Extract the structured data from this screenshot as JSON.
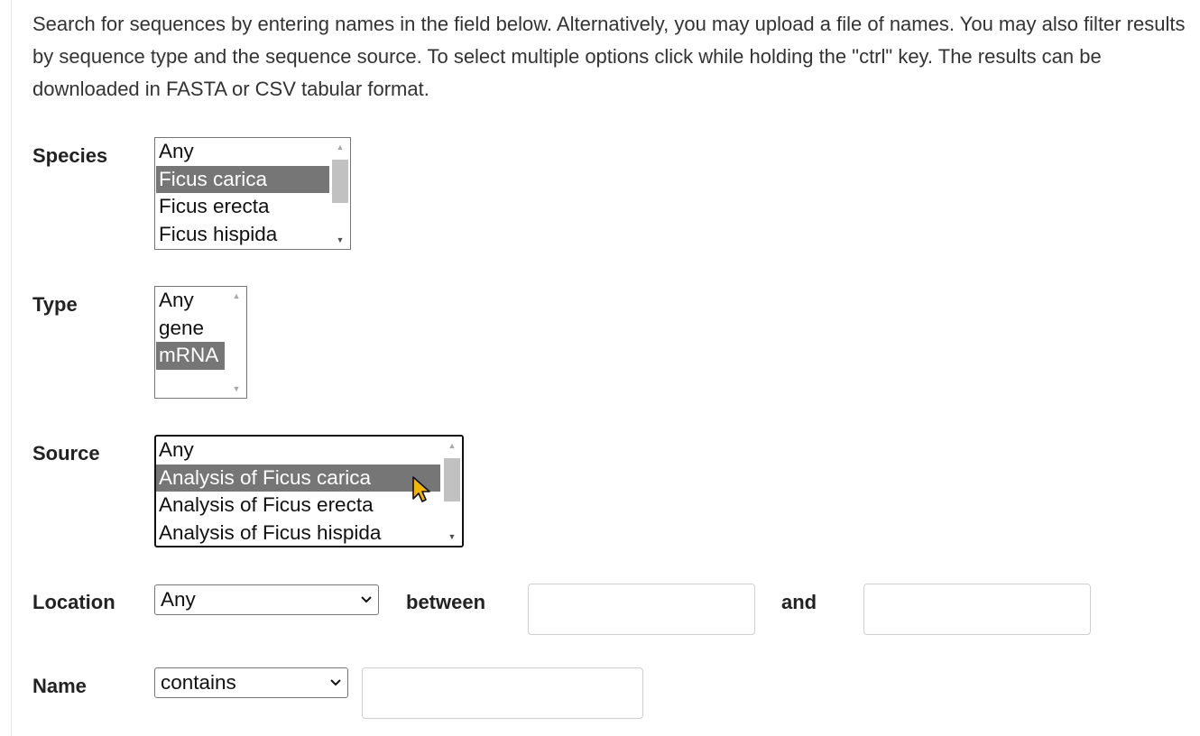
{
  "intro_text": "Search for sequences by entering names in the field below. Alternatively, you may upload a file of names. You may also filter results by sequence type and the sequence source. To select multiple options click while holding the \"ctrl\" key. The results can be downloaded in FASTA or CSV tabular format.",
  "species": {
    "label": "Species",
    "options": [
      "Any",
      "Ficus carica",
      "Ficus erecta",
      "Ficus hispida"
    ],
    "selected": "Ficus carica"
  },
  "type": {
    "label": "Type",
    "options": [
      "Any",
      "gene",
      "mRNA"
    ],
    "selected": "mRNA"
  },
  "source": {
    "label": "Source",
    "options": [
      "Any",
      "Analysis of Ficus carica",
      "Analysis of Ficus erecta",
      "Analysis of Ficus hispida"
    ],
    "selected": "Analysis of Ficus carica"
  },
  "location": {
    "label": "Location",
    "select_value": "Any",
    "between_label": "between",
    "and_label": "and",
    "start_value": "",
    "end_value": ""
  },
  "name": {
    "label": "Name",
    "select_value": "contains",
    "input_value": ""
  },
  "colors": {
    "selected_bg": "#767676",
    "cursor_fill": "#f5b400"
  },
  "icons": {
    "scroll_up": "triangle-up-icon",
    "scroll_down": "triangle-down-icon",
    "dropdown": "chevron-down-icon",
    "cursor": "mouse-pointer-icon"
  }
}
